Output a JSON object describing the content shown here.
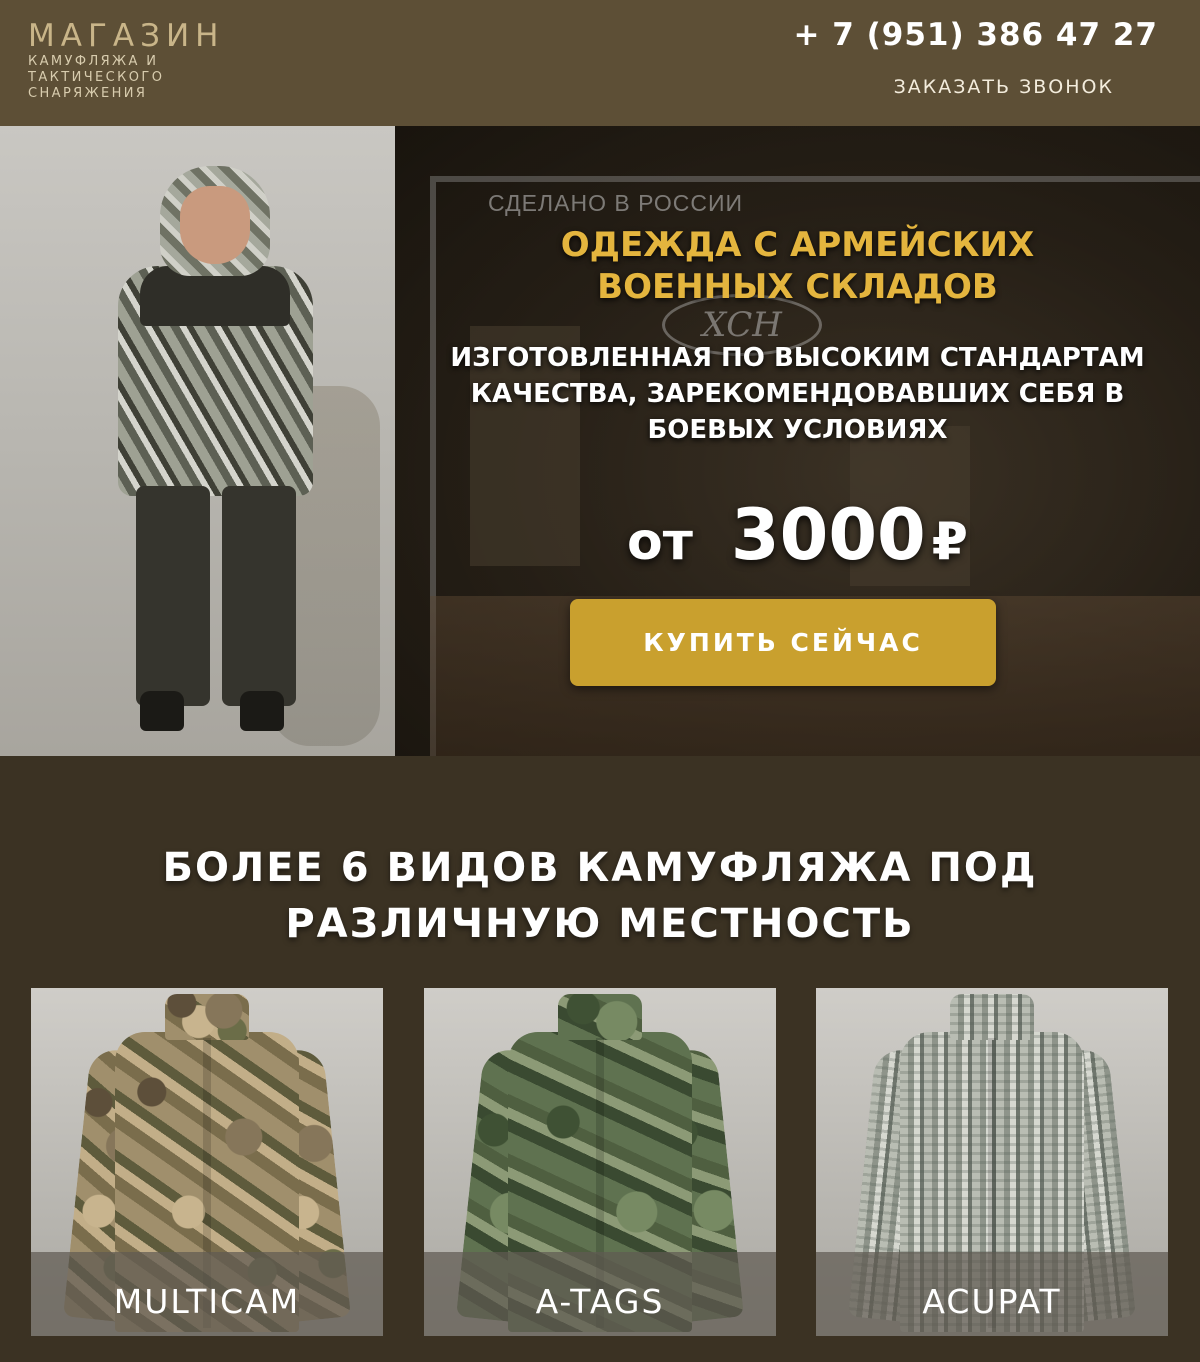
{
  "header": {
    "logo_title": "МАГАЗИН",
    "logo_sub_1": "КАМУФЛЯЖА И",
    "logo_sub_2": "ТАКТИЧЕСКОГО",
    "logo_sub_3": "СНАРЯЖЕНИЯ",
    "phone": "+ 7 (951) 386 47 27",
    "callback_label": "ЗАКАЗАТЬ ЗВОНОК"
  },
  "hero": {
    "store_sign": "СДЕЛАНО В РОССИИ",
    "store_logo": "ХСН",
    "title_line_1": "ОДЕЖДА С АРМЕЙСКИХ",
    "title_line_2": "ВОЕННЫХ СКЛАДОВ",
    "sub_line_1": "ИЗГОТОВЛЕННАЯ ПО ВЫСОКИМ СТАНДАРТАМ",
    "sub_line_2": "КАЧЕСТВА, ЗАРЕКОМЕНДОВАВШИХ СЕБЯ В",
    "sub_line_3": "БОЕВЫХ УСЛОВИЯХ",
    "price_prefix": "от",
    "price_value": "3000",
    "price_currency": "₽",
    "buy_label": "КУПИТЬ СЕЙЧАС"
  },
  "section": {
    "title_line_1": "БОЛЕЕ 6 ВИДОВ КАМУФЛЯЖА ПОД",
    "title_line_2": "РАЗЛИЧНУЮ МЕСТНОСТЬ"
  },
  "cards": [
    {
      "label": "MULTICAM"
    },
    {
      "label": "A-TAGS"
    },
    {
      "label": "ACUPAT"
    }
  ],
  "colors": {
    "header_bg": "#5d4f36",
    "page_bg": "#3b3223",
    "accent_gold": "#c9a02e",
    "title_gold": "#e4b53e"
  }
}
